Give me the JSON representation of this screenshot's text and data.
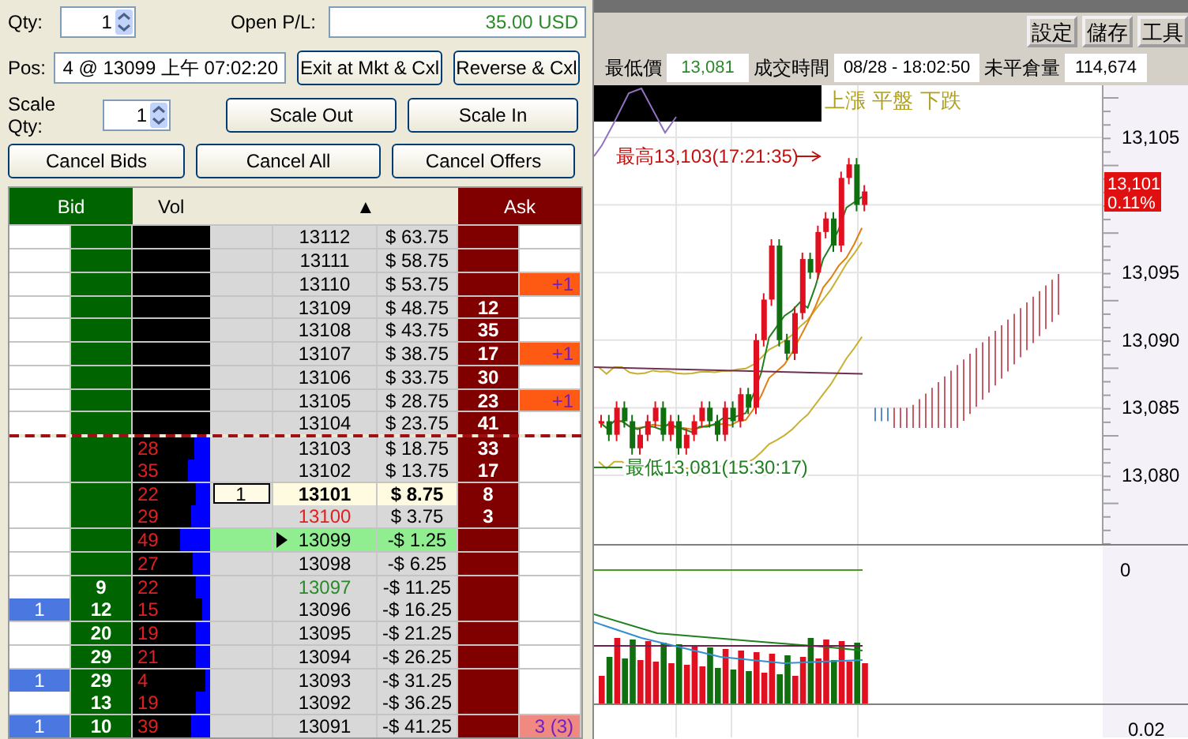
{
  "controls": {
    "qty": {
      "label": "Qty:",
      "value": "1"
    },
    "open_pl": {
      "label": "Open P/L:",
      "value": "35.00 USD"
    },
    "pos": {
      "label": "Pos:",
      "value": "4 @ 13099 上午 07:02:20"
    },
    "scale_qty": {
      "label": "Scale Qty:",
      "value": "1"
    }
  },
  "position_buttons": [
    "Exit at Mkt & Cxl",
    "Reverse & Cxl"
  ],
  "scale_buttons": [
    "Scale Out",
    "Scale In"
  ],
  "cancel_buttons": [
    "Cancel Bids",
    "Cancel All",
    "Cancel Offers"
  ],
  "ladder": {
    "columns": {
      "bid": "Bid",
      "vol": "Vol",
      "sort": "▲",
      "ask": "Ask"
    },
    "rows": [
      {
        "price": "13112",
        "pnl": "$ 63.75",
        "last": false,
        "entry": false,
        "divider": false
      },
      {
        "price": "13111",
        "pnl": "$ 58.75",
        "last": false,
        "entry": false,
        "divider": false
      },
      {
        "price": "13110",
        "pnl": "$ 53.75",
        "ask_order": {
          "text": "+1",
          "color": "#ff5a14"
        },
        "last": false,
        "entry": false,
        "divider": false
      },
      {
        "price": "13109",
        "pnl": "$ 48.75",
        "ask": "12",
        "last": false,
        "entry": false,
        "divider": false
      },
      {
        "price": "13108",
        "pnl": "$ 43.75",
        "ask": "35",
        "last": false,
        "entry": false,
        "divider": false
      },
      {
        "price": "13107",
        "pnl": "$ 38.75",
        "ask": "17",
        "ask_order": {
          "text": "+1",
          "color": "#ff5a14"
        },
        "last": false,
        "entry": false,
        "divider": false
      },
      {
        "price": "13106",
        "pnl": "$ 33.75",
        "ask": "30",
        "last": false,
        "entry": false,
        "divider": false
      },
      {
        "price": "13105",
        "pnl": "$ 28.75",
        "ask": "23",
        "ask_order": {
          "text": "+1",
          "color": "#ff5a14"
        },
        "last": false,
        "entry": false,
        "divider": false
      },
      {
        "price": "13104",
        "pnl": "$ 23.75",
        "ask": "41",
        "last": false,
        "entry": false,
        "divider": false
      },
      {
        "price": "13103",
        "pnl": "$ 18.75",
        "ask": "33",
        "vol": "28",
        "level": 0.2,
        "last": false,
        "entry": false,
        "divider": true
      },
      {
        "price": "13102",
        "pnl": "$ 13.75",
        "ask": "17",
        "vol": "35",
        "level": 0.28,
        "last": false,
        "entry": false,
        "divider": false
      },
      {
        "price": "13101",
        "pnl": "$ 8.75",
        "ask": "8",
        "vol": "22",
        "level": 0.18,
        "my_order": "1",
        "last": true,
        "entry": false,
        "divider": false
      },
      {
        "price": "13100",
        "pnl": "$ 3.75",
        "ask": "3",
        "vol": "29",
        "level": 0.24,
        "color": "#e02020",
        "last": false,
        "entry": false,
        "divider": false
      },
      {
        "price": "13099",
        "pnl": "-$ 1.25",
        "vol": "49",
        "level": 0.39,
        "last": false,
        "entry": true,
        "divider": false
      },
      {
        "price": "13098",
        "pnl": "-$ 6.25",
        "vol": "27",
        "level": 0.22,
        "last": false,
        "entry": false,
        "divider": false
      },
      {
        "price": "13097",
        "pnl": "-$ 11.25",
        "bid": "9",
        "vol": "22",
        "level": 0.18,
        "color": "#2a8a2a",
        "last": false,
        "entry": false,
        "divider": false
      },
      {
        "price": "13096",
        "pnl": "-$ 16.25",
        "bid": "12",
        "bid_order": "1",
        "vol": "15",
        "level": 0.1,
        "last": false,
        "entry": false,
        "divider": false
      },
      {
        "price": "13095",
        "pnl": "-$ 21.25",
        "bid": "20",
        "vol": "19",
        "level": 0.18,
        "last": false,
        "entry": false,
        "divider": false
      },
      {
        "price": "13094",
        "pnl": "-$ 26.25",
        "bid": "29",
        "vol": "21",
        "level": 0.18,
        "last": false,
        "entry": false,
        "divider": false
      },
      {
        "price": "13093",
        "pnl": "-$ 31.25",
        "bid": "29",
        "bid_order": "1",
        "vol": "4",
        "level": 0.06,
        "last": false,
        "entry": false,
        "divider": false
      },
      {
        "price": "13092",
        "pnl": "-$ 36.25",
        "bid": "13",
        "vol": "19",
        "level": 0.18,
        "last": false,
        "entry": false,
        "divider": false
      },
      {
        "price": "13091",
        "pnl": "-$ 41.25",
        "bid": "10",
        "bid_order": "1",
        "ask_order": {
          "text": "3 (3)",
          "color": "#f08a80"
        },
        "vol": "39",
        "level": 0.25,
        "last": false,
        "entry": false,
        "divider": false
      }
    ]
  },
  "toolbar": [
    "設定",
    "儲存",
    "工具"
  ],
  "quote": [
    {
      "label": "最低價",
      "value": "13,081",
      "color": "#2a8a2a"
    },
    {
      "label": "成交時間",
      "value": "08/28 - 18:02:50",
      "color": "#000000"
    },
    {
      "label": "未平倉量",
      "value": "114,674",
      "color": "#000000"
    }
  ],
  "chart": {
    "legend": [
      "上漲",
      "平盤",
      "下跌"
    ],
    "high_note": "最高13,103(17:21:35)",
    "low_note": "最低13,081(15:30:17)",
    "price_ticks": [
      {
        "label": "13,105",
        "kind": "tick"
      },
      {
        "label": "13,095",
        "kind": "tick"
      },
      {
        "label": "13,090",
        "kind": "tick"
      },
      {
        "label": "13,085",
        "kind": "tick"
      },
      {
        "label": "13,080",
        "kind": "tick"
      }
    ],
    "last_price": "13,101",
    "change": "0.11%",
    "volume_ticks": [
      "0",
      "0.02"
    ]
  }
}
